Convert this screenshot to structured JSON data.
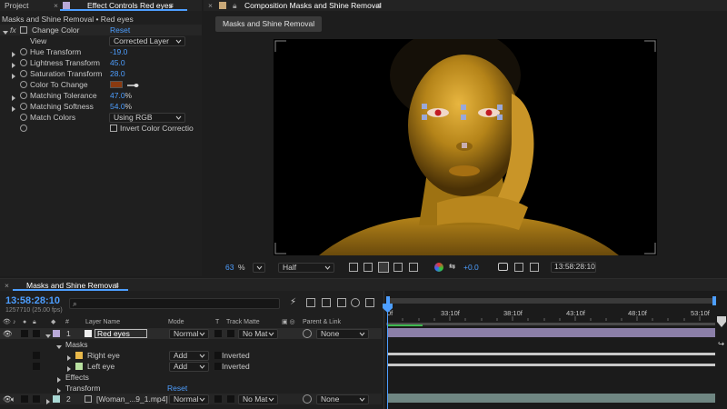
{
  "tabs_left": {
    "project": "Project",
    "effect_controls": "Effect Controls Red eyes"
  },
  "tabs_right": {
    "composition": "Composition Masks and Shine Removal"
  },
  "effect_controls": {
    "breadcrumb": "Masks and Shine Removal • Red eyes",
    "effect_name": "Change Color",
    "reset": "Reset",
    "view_label": "View",
    "view_value": "Corrected Layer",
    "hue_label": "Hue Transform",
    "hue_value": "-19.0",
    "lightness_label": "Lightness Transform",
    "lightness_value": "45.0",
    "saturation_label": "Saturation Transform",
    "saturation_value": "28.0",
    "color_to_change_label": "Color To Change",
    "matching_tolerance_label": "Matching Tolerance",
    "matching_tolerance_value": "47.0",
    "matching_softness_label": "Matching Softness",
    "matching_softness_value": "54.0",
    "percent": "%",
    "match_colors_label": "Match Colors",
    "match_colors_value": "Using RGB",
    "invert_label": "Invert Color Correctio"
  },
  "composition": {
    "flowchart_chip": "Masks and Shine Removal",
    "zoom": "63",
    "zoom_unit": "%",
    "resolution": "Half",
    "exposure": "+0.0",
    "timecode": "13:58:28:10"
  },
  "timeline": {
    "tab": "Masks and Shine Removal",
    "timecode": "13:58:28:10",
    "frame_info": "1257710 (25.00 fps)",
    "search_placeholder": "",
    "col_num": "#",
    "col_layer_name": "Layer Name",
    "col_mode": "Mode",
    "col_t": "T",
    "col_track_matte": "Track Matte",
    "col_parent": "Parent & Link",
    "ruler": [
      "33:10f",
      "38:10f",
      "43:10f",
      "48:10f",
      "53:10f"
    ],
    "ruler_start": "0f",
    "layers": [
      {
        "num": "1",
        "name": "Red eyes",
        "mode": "Normal",
        "matte": "No Mat",
        "parent": "None"
      },
      {
        "num": "2",
        "name": "[Woman_...9_1.mp4]",
        "mode": "Normal",
        "matte": "No Mat",
        "parent": "None"
      }
    ],
    "masks_label": "Masks",
    "masks": [
      {
        "name": "Right eye",
        "mode": "Add",
        "inverted": "Inverted",
        "color": "#e8b84a"
      },
      {
        "name": "Left eye",
        "mode": "Add",
        "inverted": "Inverted",
        "color": "#b8e0a0"
      }
    ],
    "effects_label": "Effects",
    "transform_label": "Transform",
    "transform_reset": "Reset"
  },
  "colors": {
    "accent": "#4d9eff",
    "layer1_label": "#b9a9d8",
    "layer2_label": "#a9d8d4",
    "color_swatch": "#8a3a10"
  }
}
